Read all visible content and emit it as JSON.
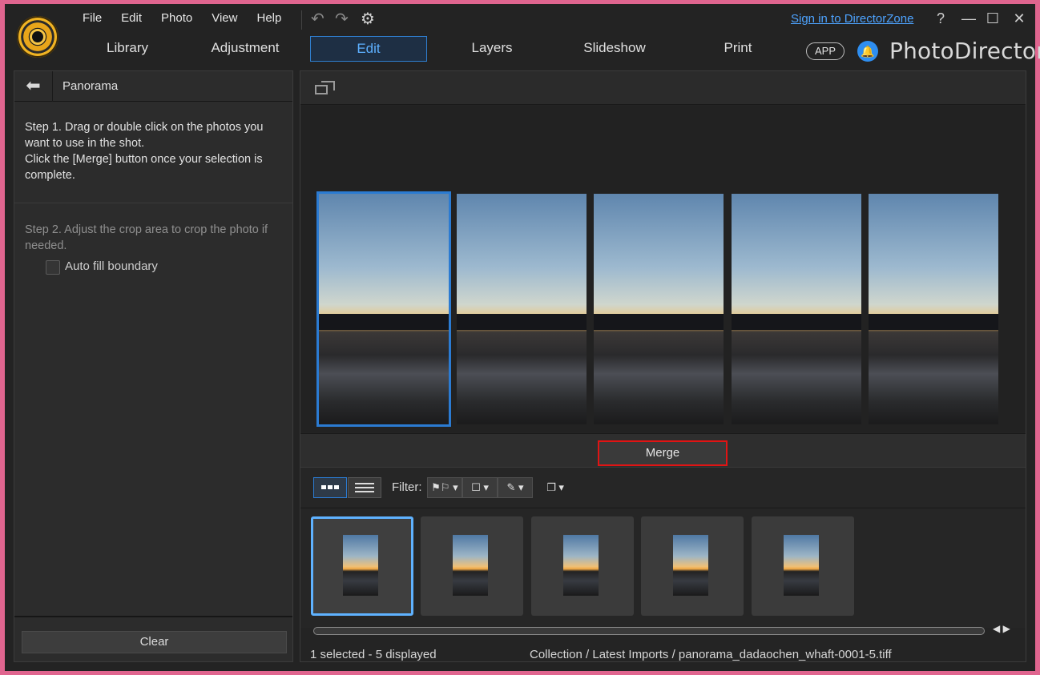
{
  "menu": [
    "File",
    "Edit",
    "Photo",
    "View",
    "Help"
  ],
  "toolbar": {
    "undo_icon": "undo-icon",
    "redo_icon": "redo-icon",
    "settings_icon": "settings-icon"
  },
  "signin_link": "Sign in to DirectorZone",
  "window_controls": {
    "help": "?",
    "minimize": "—",
    "maximize": "☐",
    "close": "✕"
  },
  "tabs": [
    {
      "label": "Library",
      "active": false
    },
    {
      "label": "Adjustment",
      "active": false
    },
    {
      "label": "Edit",
      "active": true
    },
    {
      "label": "Layers",
      "active": false
    },
    {
      "label": "Slideshow",
      "active": false
    },
    {
      "label": "Print",
      "active": false
    }
  ],
  "app_badge": "APP",
  "brand": "PhotoDirector",
  "left_panel": {
    "title": "Panorama",
    "step1": "Step 1. Drag or double click on the photos you want to use in the shot.\nClick the [Merge] button once your selection is complete.",
    "step2": "Step 2. Adjust the crop area to crop the photo if needed.",
    "auto_fill_label": "Auto fill boundary",
    "auto_fill_checked": false,
    "clear_label": "Clear"
  },
  "merge_label": "Merge",
  "filter_label": "Filter:",
  "photos_count": 5,
  "selected_index": 0,
  "status": {
    "selection": "1 selected - 5 displayed",
    "path": "Collection / Latest Imports / panorama_dadaochen_whaft-0001-5.tiff"
  },
  "colors": {
    "accent": "#2b7bd2",
    "merge_highlight": "#e01414",
    "link": "#4da3ff"
  }
}
